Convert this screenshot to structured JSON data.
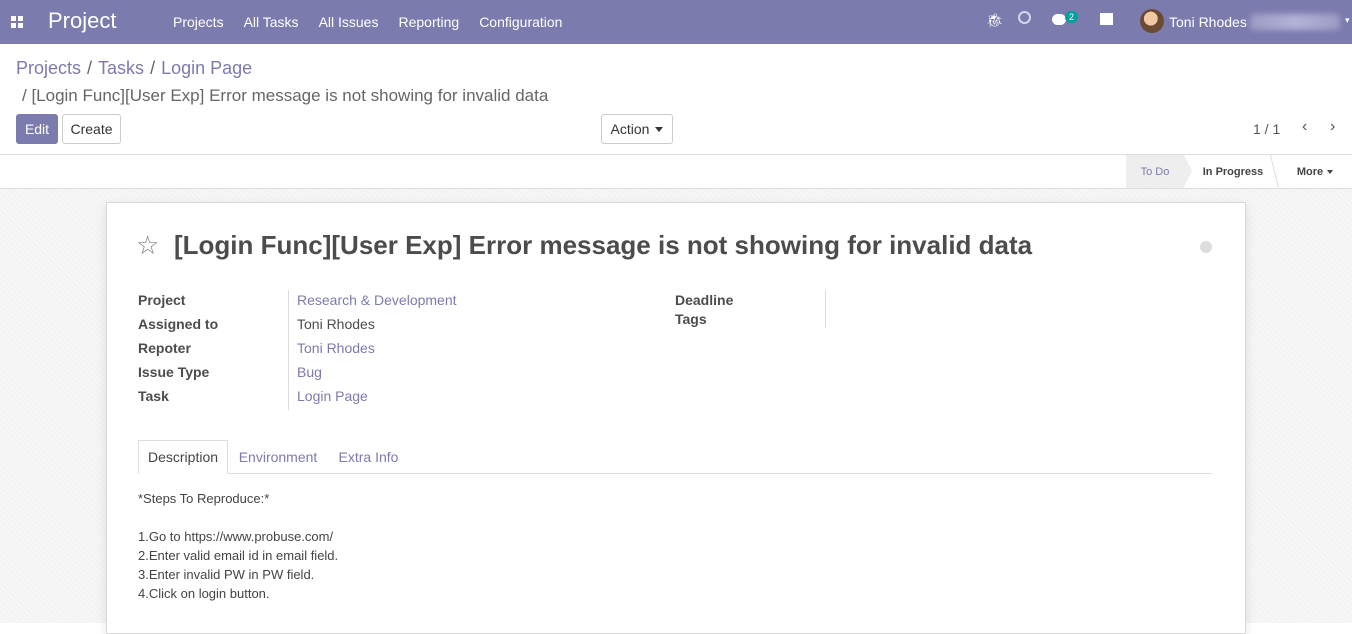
{
  "navbar": {
    "app_title": "Project",
    "menu": [
      "Projects",
      "All Tasks",
      "All Issues",
      "Reporting",
      "Configuration"
    ],
    "chat_count": "2",
    "user_name": "Toni Rhodes",
    "bg_color": "#7c7bad"
  },
  "breadcrumb": {
    "items": [
      "Projects",
      "Tasks",
      "Login Page"
    ],
    "sep": "/",
    "subtitle": "/ [Login Func][User Exp] Error message is not showing for invalid data"
  },
  "toolbar": {
    "edit_label": "Edit",
    "create_label": "Create",
    "action_label": "Action",
    "pager": "1 / 1"
  },
  "statusbar": {
    "stages": [
      "To Do",
      "In Progress"
    ],
    "more_label": "More"
  },
  "form": {
    "title": "[Login Func][User Exp] Error message is not showing for invalid data",
    "fields": {
      "project_label": "Project",
      "project_value": "Research & Development",
      "assigned_label": "Assigned to",
      "assigned_value": "Toni Rhodes",
      "reporter_label": "Repoter",
      "reporter_value": "Toni Rhodes",
      "issue_type_label": "Issue Type",
      "issue_type_value": "Bug",
      "task_label": "Task",
      "task_value": "Login Page",
      "deadline_label": "Deadline",
      "tags_label": "Tags"
    },
    "tabs": [
      "Description",
      "Environment",
      "Extra Info"
    ],
    "description": [
      "*Steps To Reproduce:*",
      "1.Go to https://www.probuse.com/",
      "2.Enter valid email id in email field.",
      "3.Enter invalid PW in PW field.",
      "4.Click on login button."
    ]
  }
}
